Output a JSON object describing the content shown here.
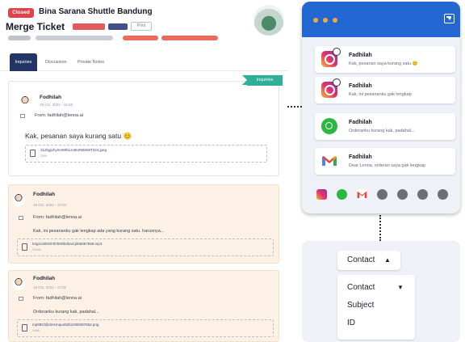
{
  "ticket": {
    "status_badge": "Closed",
    "company": "Bina Sarana Shuttle Bandung",
    "merge_title": "Merge Ticket",
    "pills": [
      "",
      ""
    ],
    "print_label": "Print",
    "tabs": [
      "Inquiries",
      "Discussion",
      "Private Notes"
    ],
    "tag": "Inquiries",
    "messages": [
      {
        "name": "Fodhilah",
        "date": "18 Oct, 2022 - 16:33",
        "from": "From: fadhilah@lenna.ai",
        "body": "Kak, pesanan saya kurang satu 😊",
        "file": "312bgjuhymn98hiLm9ert66608T324.jpeg",
        "size": "23Kb"
      },
      {
        "name": "Fodhilah",
        "date": "18 Oct, 2022 - 17:04",
        "from": "From: fadhilah@lenna.ai",
        "body": "Kak, ini pesananku gak lengkap ada yang kurang satu. harusnya...",
        "file": "54gs1300GhhhhNhbrikar1j066087558.mp3",
        "size": "234Mb"
      },
      {
        "name": "Fodhilah",
        "date": "18 Oct, 2022 - 17:02",
        "from": "From: fadhilah@lenna.ai",
        "body": "Orderanku kurang kak, padahal...",
        "file": "mp59Gl@dreUnquo92hi1066087552.png",
        "size": "44Mb"
      }
    ]
  },
  "inbox": {
    "conversations": [
      {
        "channel": "instagram-icon",
        "name": "Fadhilah",
        "preview": "Kak, pesanan saya kurang satu 😊"
      },
      {
        "channel": "instagram-icon",
        "name": "Fadhilah",
        "preview": "Kak, ini pesananku gak lengkap"
      },
      {
        "channel": "whatsapp-icon",
        "name": "Fadhilah",
        "preview": "Orderanku kurang kak, padahal..."
      },
      {
        "channel": "gmail-icon",
        "name": "Fadhilah",
        "preview": "Dear Lenna, orderan saya gak lengkap"
      }
    ],
    "channels": [
      "instagram-icon",
      "whatsapp-icon",
      "gmail-icon",
      "telegram-icon",
      "messenger-icon",
      "chat-icon",
      "twitter-icon"
    ]
  },
  "contact": {
    "button_label": "Contact",
    "options": [
      "Contact",
      "Subject",
      "ID"
    ]
  },
  "colors": {
    "accent": "#2368d2",
    "navy": "#233566",
    "teal": "#2fae9a",
    "closed": "#e0434a",
    "peach": "#fdf1e6"
  }
}
